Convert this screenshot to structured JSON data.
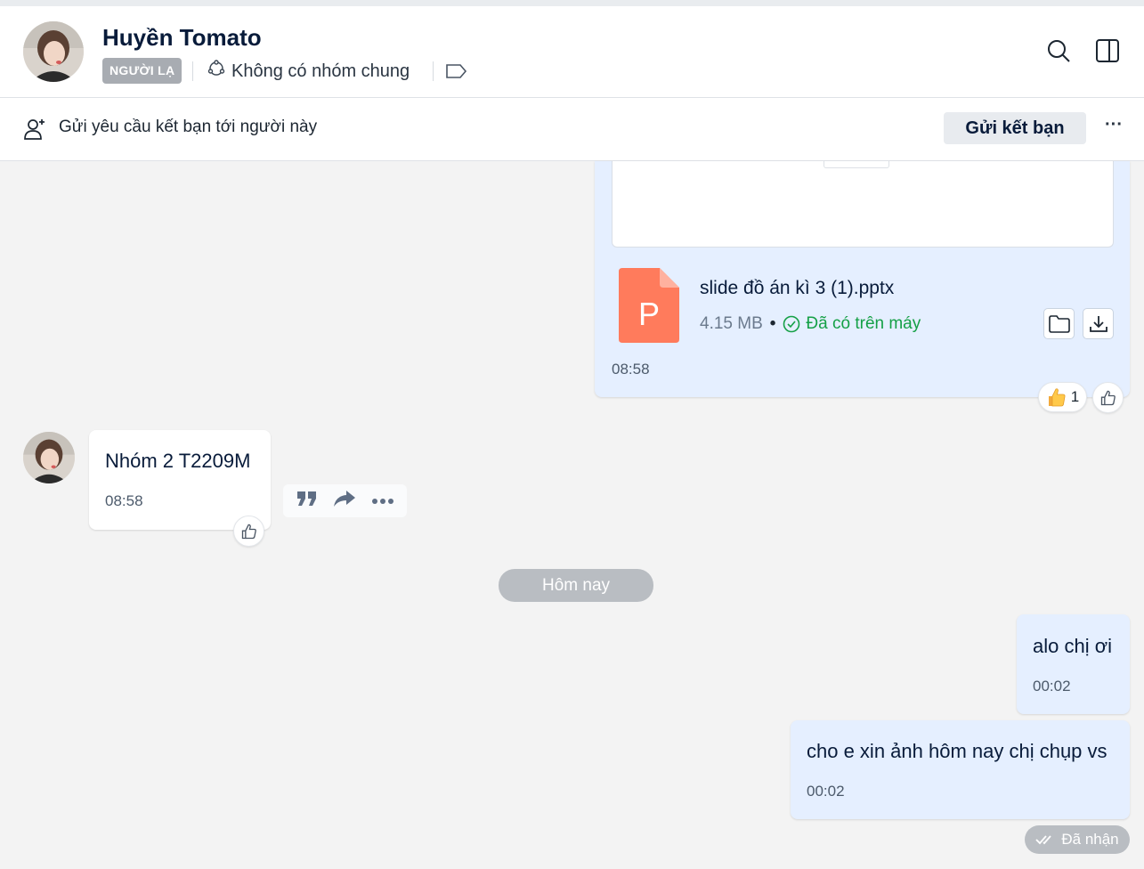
{
  "header": {
    "contact_name": "Huyền Tomato",
    "badge": "NGƯỜI LẠ",
    "common_groups": "Không có nhóm chung"
  },
  "friend_request": {
    "text": "Gửi yêu cầu kết bạn tới người này",
    "button_label": "Gửi kết bạn",
    "more_label": "···"
  },
  "file_message": {
    "file_name": "slide đồ án kì 3 (1).pptx",
    "file_type_letter": "P",
    "size": "4.15 MB",
    "status": "Đã có trên máy",
    "time": "08:58",
    "reaction_count": "1"
  },
  "incoming_message": {
    "text": "Nhóm 2 T2209M",
    "time": "08:58"
  },
  "date_divider": "Hôm nay",
  "outgoing_messages": [
    {
      "text": "alo chị ơi",
      "time": "00:02"
    },
    {
      "text": "cho e xin ảnh hôm nay chị chụp vs",
      "time": "00:02"
    }
  ],
  "delivery_status": "Đã nhận",
  "colors": {
    "outgoing_bubble": "#e5efff",
    "accent_green": "#15a046",
    "ppt_orange": "#ff7b5c"
  }
}
